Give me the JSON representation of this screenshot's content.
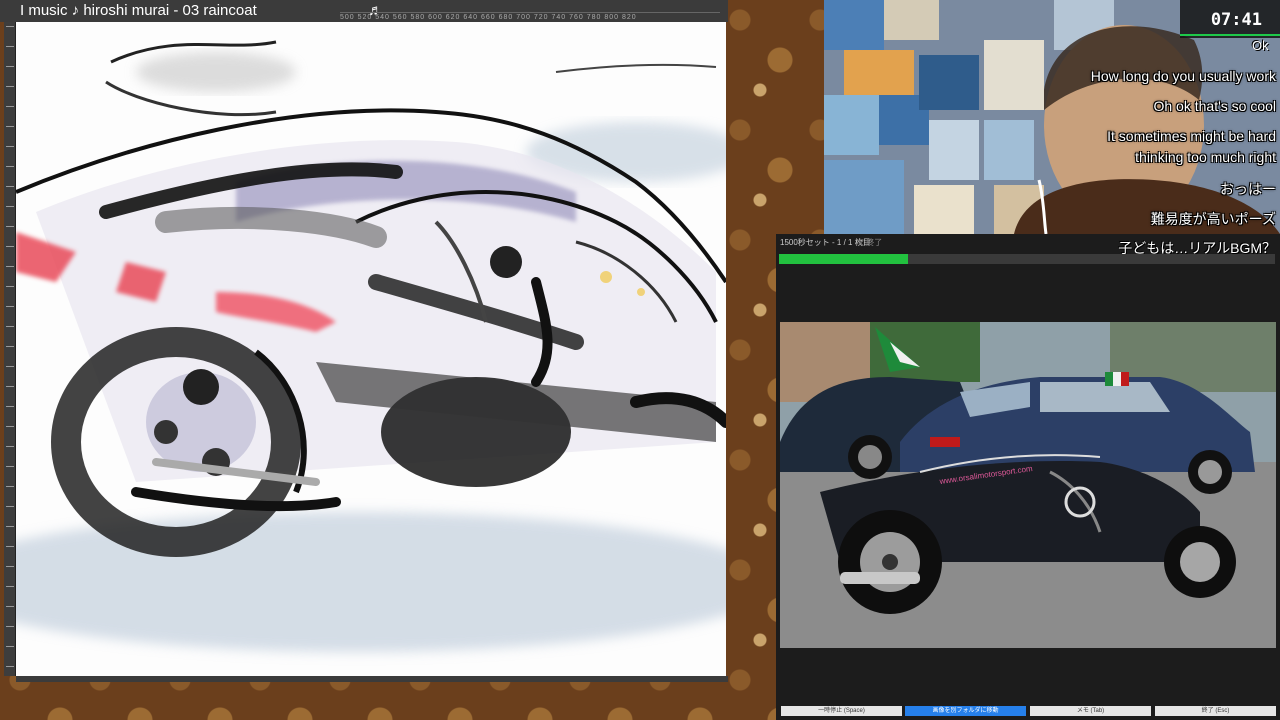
{
  "window": {
    "title": "I music ♪ hiroshi murai - 03 raincoat",
    "title_note": "♬",
    "ruler_marks": "500  520  540  560  580  600  620  640  660  680  700  720  740  760  780  800  820"
  },
  "stream": {
    "timer": "07:41",
    "ok_label": "Ok",
    "chat": [
      "How long do you usually work",
      "Oh ok that's so cool",
      "It sometimes might be hard",
      "thinking too much right",
      "おっはー",
      "難易度が高いポーズ"
    ]
  },
  "reference_app": {
    "header": "1500秒セット - 1 / 1 枚目",
    "close_label": "次 終了",
    "overlay_title": "子どもは…リアルBGM？",
    "progress": 0.26,
    "photo_text": "www.orsalimotorsport.com",
    "buttons": [
      {
        "label": "一時停止 (Space)",
        "primary": false
      },
      {
        "label": "画像を別フォルダに移動",
        "primary": true
      },
      {
        "label": "メモ (Tab)",
        "primary": false
      },
      {
        "label": "終了 (Esc)",
        "primary": false
      }
    ]
  },
  "colors": {
    "progress_green": "#22c13f",
    "primary_button": "#2680eb",
    "titlebar": "#3b3b3b"
  }
}
